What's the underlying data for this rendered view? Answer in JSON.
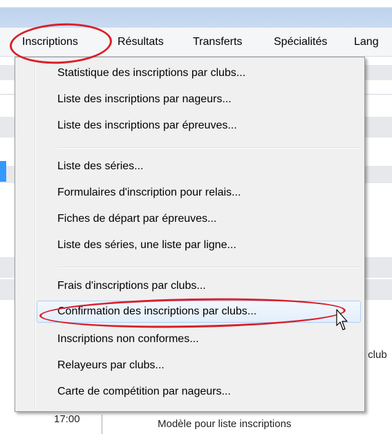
{
  "menubar": {
    "items": [
      "Inscriptions",
      "Résultats",
      "Transferts",
      "Spécialités",
      "Lang"
    ]
  },
  "dropdown": {
    "groups": [
      [
        "Statistique des inscriptions par clubs...",
        "Liste des inscriptions par nageurs...",
        "Liste des inscriptions par épreuves..."
      ],
      [
        "Liste des séries...",
        "Formulaires d'inscription pour relais...",
        "Fiches de départ par épreuves...",
        "Liste des séries, une liste par ligne..."
      ],
      [
        "Frais d'inscriptions par clubs...",
        "Confirmation des inscriptions par clubs...",
        "Inscriptions non conformes...",
        "Relayeurs par clubs...",
        "Carte de compétition par nageurs..."
      ]
    ],
    "highlighted": "Confirmation des inscriptions par clubs..."
  },
  "background": {
    "time": "17:00",
    "bottom_label": "Modèle pour liste inscriptions",
    "club_fragment": "r club"
  },
  "colors": {
    "annotation": "#d8202a",
    "selection": "#3399ff",
    "menu_bg": "#f0f0f0"
  }
}
